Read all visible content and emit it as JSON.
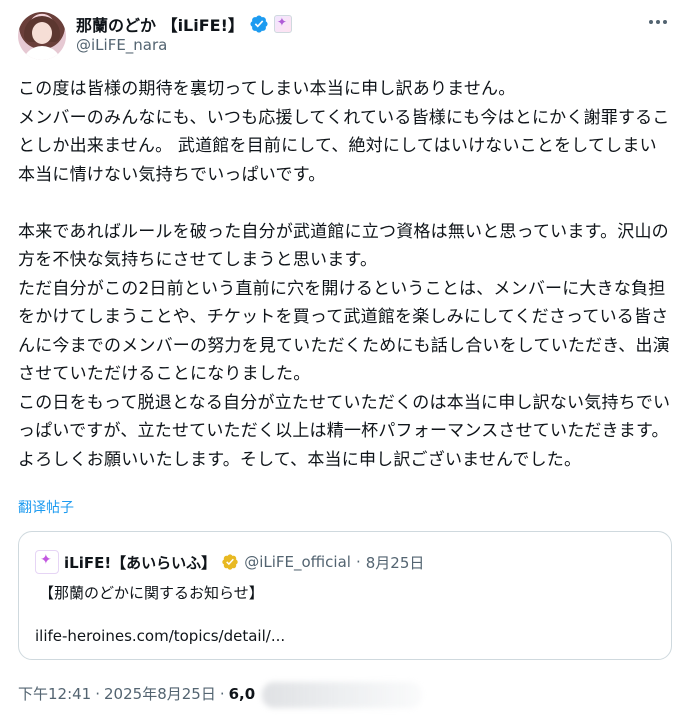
{
  "author": {
    "display_name": "那蘭のどか 【iLiFE!】",
    "handle": "@iLiFE_nara"
  },
  "tweet": {
    "text": "この度は皆様の期待を裏切ってしまい本当に申し訳ありません。\nメンバーのみんなにも、いつも応援してくれている皆様にも今はとにかく謝罪することしか出来ません。 武道館を目前にして、絶対にしてはいけないことをしてしまい本当に情けない気持ちでいっぱいです。\n\n本来であればルールを破った自分が武道館に立つ資格は無いと思っています。沢山の方を不快な気持ちにさせてしまうと思います。\nただ自分がこの2日前という直前に穴を開けるということは、メンバーに大きな負担をかけてしまうことや、チケットを買って武道館を楽しみにしてくださっている皆さんに今までのメンバーの努力を見ていただくためにも話し合いをしていただき、出演させていただけることになりました。\nこの日をもって脱退となる自分が立たせていただくのは本当に申し訳ない気持ちでいっぱいですが、立たせていただく以上は精一杯パフォーマンスさせていただきます。\nよろしくお願いいたします。そして、本当に申し訳ございませんでした。",
    "translate_label": "翻译帖子"
  },
  "quote": {
    "name": "iLiFE!【あいらいふ】",
    "handle": "@iLiFE_official",
    "dot": "·",
    "date": "8月25日",
    "line1": "【那蘭のどかに関するお知らせ】",
    "line2": "ilife-heroines.com/topics/detail/..."
  },
  "meta": {
    "time": "下午12:41",
    "dot1": "·",
    "date": "2025年8月25日",
    "dot2": "·",
    "views_partial": "6,0"
  },
  "colors": {
    "text": "#0f1419",
    "secondary": "#536471",
    "link": "#1d9bf0",
    "verified": "#1d9bf0",
    "quote_verified": "#e8b923",
    "border": "#cfd9de"
  },
  "icons": {
    "verified": "verified-badge-icon",
    "affiliate": "affiliate-badge-icon",
    "more": "more-options-icon",
    "quote_verified": "gold-verified-badge-icon"
  }
}
